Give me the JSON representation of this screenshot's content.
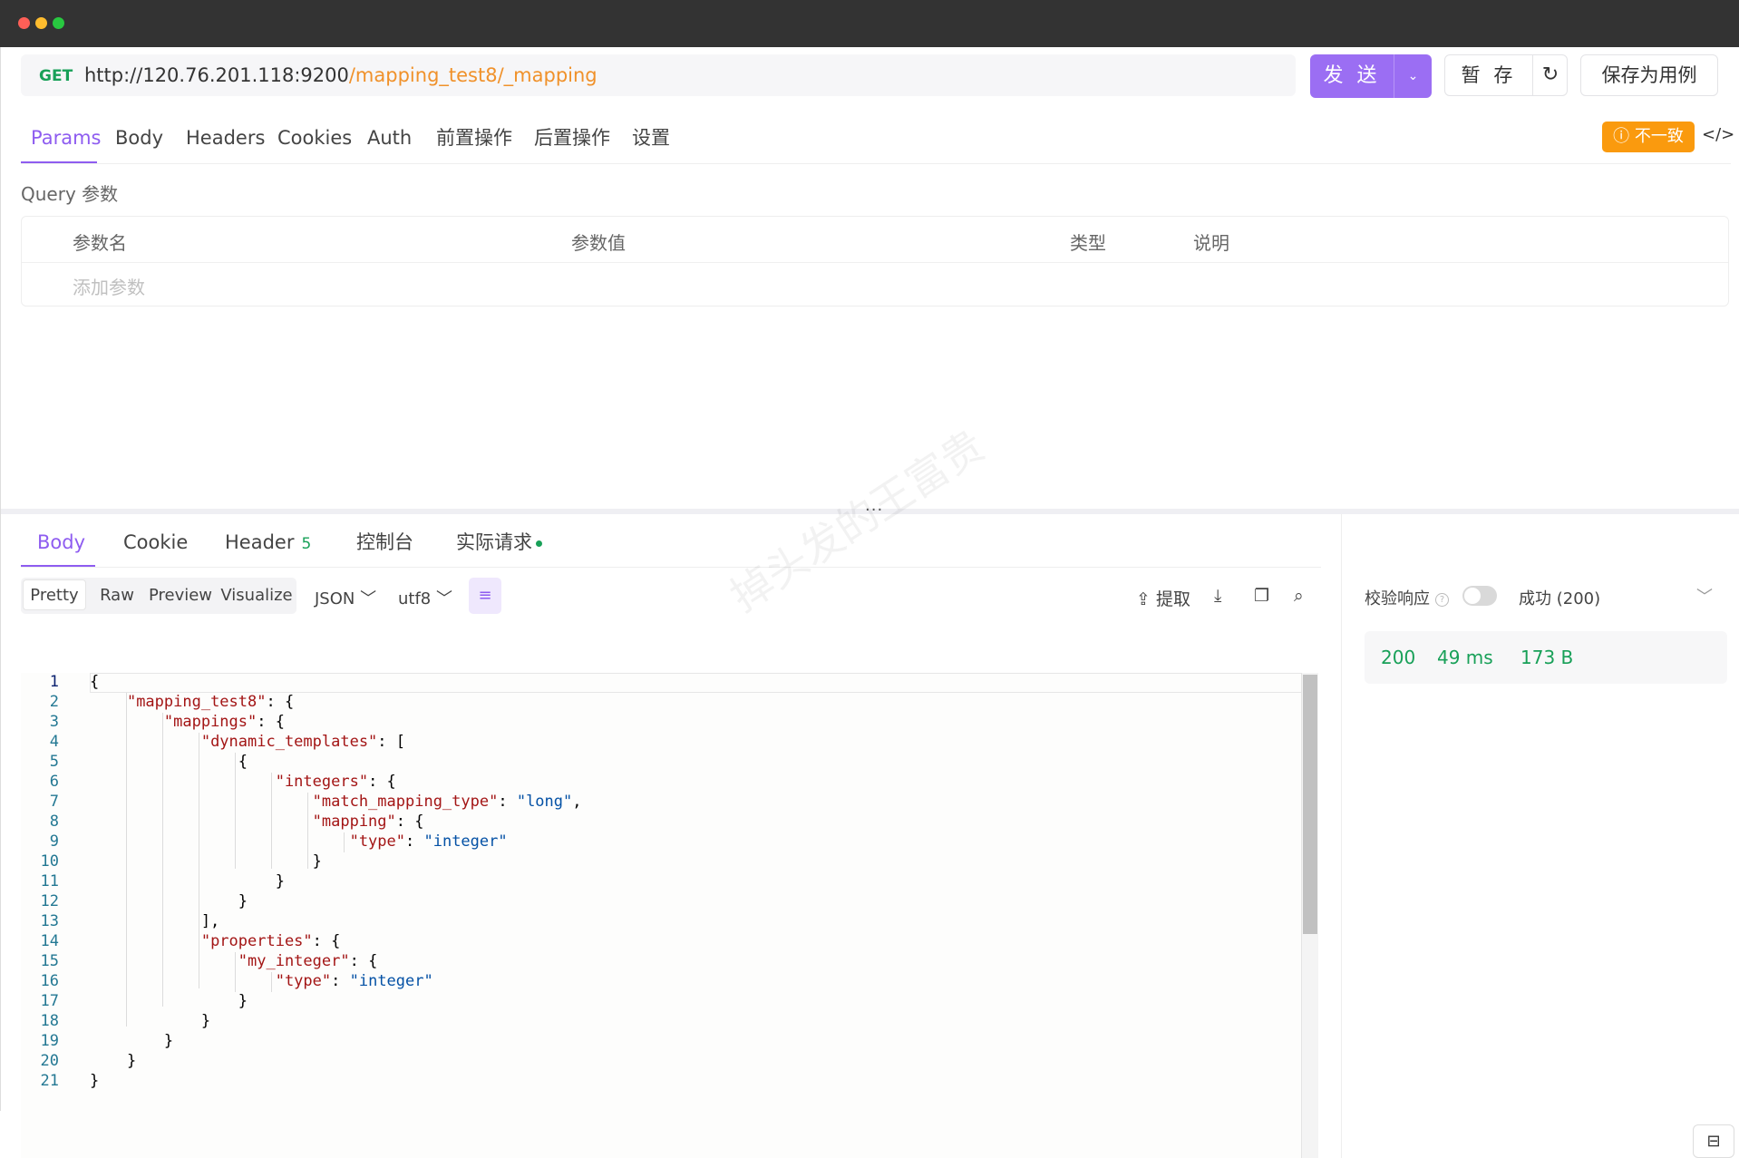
{
  "request": {
    "method": "GET",
    "url_host": "http://120.76.201.118:9200",
    "url_path": "/mapping_test8/_mapping",
    "send_label": "发 送",
    "save_tmp_label": "暂 存",
    "save_case_label": "保存为用例"
  },
  "tabs": [
    "Params",
    "Body",
    "Headers",
    "Cookies",
    "Auth",
    "前置操作",
    "后置操作",
    "设置"
  ],
  "inconsistent_label": "不一致",
  "query": {
    "title": "Query 参数",
    "headers": [
      "参数名",
      "参数值",
      "类型",
      "说明"
    ],
    "add_placeholder": "添加参数"
  },
  "response": {
    "tabs": {
      "body": "Body",
      "cookie": "Cookie",
      "header": "Header",
      "header_count": "5",
      "console": "控制台",
      "actual": "实际请求"
    },
    "view_modes": [
      "Pretty",
      "Raw",
      "Preview",
      "Visualize"
    ],
    "format": "JSON",
    "encoding": "utf8",
    "extract_label": "提取",
    "verify_label": "校验响应",
    "status_text": "成功 (200)",
    "status_code": "200",
    "time": "49 ms",
    "size": "173 B"
  },
  "code_lines": [
    "{",
    "    \"mapping_test8\": {",
    "        \"mappings\": {",
    "            \"dynamic_templates\": [",
    "                {",
    "                    \"integers\": {",
    "                        \"match_mapping_type\": \"long\",",
    "                        \"mapping\": {",
    "                            \"type\": \"integer\"",
    "                        }",
    "                    }",
    "                }",
    "            ],",
    "            \"properties\": {",
    "                \"my_integer\": {",
    "                    \"type\": \"integer\"",
    "                }",
    "            }",
    "        }",
    "    }",
    "}"
  ],
  "watermark": "掉头发的王富贵",
  "colors": {
    "accent": "#8e5cf0",
    "send": "#9b6ef3",
    "success": "#18a058",
    "warning": "#fa9a0e",
    "url_path": "#f0912a"
  }
}
